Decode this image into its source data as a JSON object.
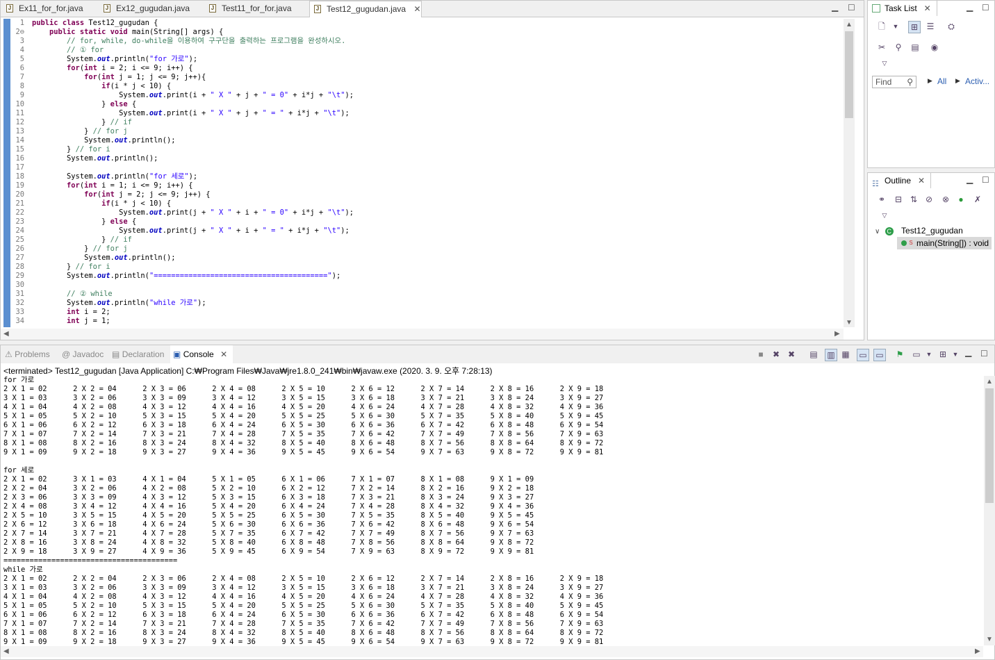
{
  "editor": {
    "tabs": [
      {
        "label": "Ex11_for_for.java",
        "active": false
      },
      {
        "label": "Ex12_gugudan.java",
        "active": false
      },
      {
        "label": "Test11_for_for.java",
        "active": false
      },
      {
        "label": "Test12_gugudan.java",
        "active": true
      }
    ],
    "code_lines": [
      {
        "n": "1",
        "t": "public class Test12_gugudan {"
      },
      {
        "n": "2⊖",
        "t": "    public static void main(String[] args) {"
      },
      {
        "n": "3",
        "t": "        // for, while, do-while을 이용하여 구구단을 출력하는 프로그램을 완성하시오."
      },
      {
        "n": "4",
        "t": "        // ① for"
      },
      {
        "n": "5",
        "t": "        System.out.println(\"for 가로\");"
      },
      {
        "n": "6",
        "t": "        for(int i = 2; i <= 9; i++) {"
      },
      {
        "n": "7",
        "t": "            for(int j = 1; j <= 9; j++){"
      },
      {
        "n": "8",
        "t": "                if(i * j < 10) {"
      },
      {
        "n": "9",
        "t": "                    System.out.print(i + \" X \" + j + \" = 0\" + i*j + \"\\t\");"
      },
      {
        "n": "10",
        "t": "                } else {"
      },
      {
        "n": "11",
        "t": "                    System.out.print(i + \" X \" + j + \" = \" + i*j + \"\\t\");"
      },
      {
        "n": "12",
        "t": "                } // if"
      },
      {
        "n": "13",
        "t": "            } // for j"
      },
      {
        "n": "14",
        "t": "            System.out.println();"
      },
      {
        "n": "15",
        "t": "        } // for i"
      },
      {
        "n": "16",
        "t": "        System.out.println();"
      },
      {
        "n": "17",
        "t": ""
      },
      {
        "n": "18",
        "t": "        System.out.println(\"for 세로\");"
      },
      {
        "n": "19",
        "t": "        for(int i = 1; i <= 9; i++) {"
      },
      {
        "n": "20",
        "t": "            for(int j = 2; j <= 9; j++) {"
      },
      {
        "n": "21",
        "t": "                if(i * j < 10) {"
      },
      {
        "n": "22",
        "t": "                    System.out.print(j + \" X \" + i + \" = 0\" + i*j + \"\\t\");"
      },
      {
        "n": "23",
        "t": "                } else {"
      },
      {
        "n": "24",
        "t": "                    System.out.print(j + \" X \" + i + \" = \" + i*j + \"\\t\");"
      },
      {
        "n": "25",
        "t": "                } // if"
      },
      {
        "n": "26",
        "t": "            } // for j"
      },
      {
        "n": "27",
        "t": "            System.out.println();"
      },
      {
        "n": "28",
        "t": "        } // for i"
      },
      {
        "n": "29",
        "t": "        System.out.println(\"========================================\");"
      },
      {
        "n": "30",
        "t": ""
      },
      {
        "n": "31",
        "t": "        // ② while"
      },
      {
        "n": "32",
        "t": "        System.out.println(\"while 가로\");"
      },
      {
        "n": "33",
        "t": "        int i = 2;"
      },
      {
        "n": "34",
        "t": "        int j = 1;"
      }
    ]
  },
  "task_list": {
    "title": "Task List",
    "find_placeholder": "Find",
    "filter_all": "All",
    "filter_activate": "Activ..."
  },
  "outline": {
    "title": "Outline",
    "class_name": "Test12_gugudan",
    "method": "main(String[]) : void"
  },
  "console": {
    "tabs": [
      {
        "label": "Problems",
        "active": false
      },
      {
        "label": "Javadoc",
        "active": false
      },
      {
        "label": "Declaration",
        "active": false
      },
      {
        "label": "Console",
        "active": true
      }
    ],
    "status": "<terminated> Test12_gugudan [Java Application] C:₩Program Files₩Java₩jre1.8.0_241₩bin₩javaw.exe (2020. 3. 9. 오후 7:28:13)",
    "output": [
      "for 가로",
      "2 X 1 = 02\t2 X 2 = 04\t2 X 3 = 06\t2 X 4 = 08\t2 X 5 = 10\t2 X 6 = 12\t2 X 7 = 14\t2 X 8 = 16\t2 X 9 = 18",
      "3 X 1 = 03\t3 X 2 = 06\t3 X 3 = 09\t3 X 4 = 12\t3 X 5 = 15\t3 X 6 = 18\t3 X 7 = 21\t3 X 8 = 24\t3 X 9 = 27",
      "4 X 1 = 04\t4 X 2 = 08\t4 X 3 = 12\t4 X 4 = 16\t4 X 5 = 20\t4 X 6 = 24\t4 X 7 = 28\t4 X 8 = 32\t4 X 9 = 36",
      "5 X 1 = 05\t5 X 2 = 10\t5 X 3 = 15\t5 X 4 = 20\t5 X 5 = 25\t5 X 6 = 30\t5 X 7 = 35\t5 X 8 = 40\t5 X 9 = 45",
      "6 X 1 = 06\t6 X 2 = 12\t6 X 3 = 18\t6 X 4 = 24\t6 X 5 = 30\t6 X 6 = 36\t6 X 7 = 42\t6 X 8 = 48\t6 X 9 = 54",
      "7 X 1 = 07\t7 X 2 = 14\t7 X 3 = 21\t7 X 4 = 28\t7 X 5 = 35\t7 X 6 = 42\t7 X 7 = 49\t7 X 8 = 56\t7 X 9 = 63",
      "8 X 1 = 08\t8 X 2 = 16\t8 X 3 = 24\t8 X 4 = 32\t8 X 5 = 40\t8 X 6 = 48\t8 X 7 = 56\t8 X 8 = 64\t8 X 9 = 72",
      "9 X 1 = 09\t9 X 2 = 18\t9 X 3 = 27\t9 X 4 = 36\t9 X 5 = 45\t9 X 6 = 54\t9 X 7 = 63\t9 X 8 = 72\t9 X 9 = 81",
      "",
      "for 세로",
      "2 X 1 = 02\t3 X 1 = 03\t4 X 1 = 04\t5 X 1 = 05\t6 X 1 = 06\t7 X 1 = 07\t8 X 1 = 08\t9 X 1 = 09",
      "2 X 2 = 04\t3 X 2 = 06\t4 X 2 = 08\t5 X 2 = 10\t6 X 2 = 12\t7 X 2 = 14\t8 X 2 = 16\t9 X 2 = 18",
      "2 X 3 = 06\t3 X 3 = 09\t4 X 3 = 12\t5 X 3 = 15\t6 X 3 = 18\t7 X 3 = 21\t8 X 3 = 24\t9 X 3 = 27",
      "2 X 4 = 08\t3 X 4 = 12\t4 X 4 = 16\t5 X 4 = 20\t6 X 4 = 24\t7 X 4 = 28\t8 X 4 = 32\t9 X 4 = 36",
      "2 X 5 = 10\t3 X 5 = 15\t4 X 5 = 20\t5 X 5 = 25\t6 X 5 = 30\t7 X 5 = 35\t8 X 5 = 40\t9 X 5 = 45",
      "2 X 6 = 12\t3 X 6 = 18\t4 X 6 = 24\t5 X 6 = 30\t6 X 6 = 36\t7 X 6 = 42\t8 X 6 = 48\t9 X 6 = 54",
      "2 X 7 = 14\t3 X 7 = 21\t4 X 7 = 28\t5 X 7 = 35\t6 X 7 = 42\t7 X 7 = 49\t8 X 7 = 56\t9 X 7 = 63",
      "2 X 8 = 16\t3 X 8 = 24\t4 X 8 = 32\t5 X 8 = 40\t6 X 8 = 48\t7 X 8 = 56\t8 X 8 = 64\t9 X 8 = 72",
      "2 X 9 = 18\t3 X 9 = 27\t4 X 9 = 36\t5 X 9 = 45\t6 X 9 = 54\t7 X 9 = 63\t8 X 9 = 72\t9 X 9 = 81",
      "========================================",
      "while 가로",
      "2 X 1 = 02\t2 X 2 = 04\t2 X 3 = 06\t2 X 4 = 08\t2 X 5 = 10\t2 X 6 = 12\t2 X 7 = 14\t2 X 8 = 16\t2 X 9 = 18",
      "3 X 1 = 03\t3 X 2 = 06\t3 X 3 = 09\t3 X 4 = 12\t3 X 5 = 15\t3 X 6 = 18\t3 X 7 = 21\t3 X 8 = 24\t3 X 9 = 27",
      "4 X 1 = 04\t4 X 2 = 08\t4 X 3 = 12\t4 X 4 = 16\t4 X 5 = 20\t4 X 6 = 24\t4 X 7 = 28\t4 X 8 = 32\t4 X 9 = 36",
      "5 X 1 = 05\t5 X 2 = 10\t5 X 3 = 15\t5 X 4 = 20\t5 X 5 = 25\t5 X 6 = 30\t5 X 7 = 35\t5 X 8 = 40\t5 X 9 = 45",
      "6 X 1 = 06\t6 X 2 = 12\t6 X 3 = 18\t6 X 4 = 24\t6 X 5 = 30\t6 X 6 = 36\t6 X 7 = 42\t6 X 8 = 48\t6 X 9 = 54",
      "7 X 1 = 07\t7 X 2 = 14\t7 X 3 = 21\t7 X 4 = 28\t7 X 5 = 35\t7 X 6 = 42\t7 X 7 = 49\t7 X 8 = 56\t7 X 9 = 63",
      "8 X 1 = 08\t8 X 2 = 16\t8 X 3 = 24\t8 X 4 = 32\t8 X 5 = 40\t8 X 6 = 48\t8 X 7 = 56\t8 X 8 = 64\t8 X 9 = 72",
      "9 X 1 = 09\t9 X 2 = 18\t9 X 3 = 27\t9 X 4 = 36\t9 X 5 = 45\t9 X 6 = 54\t9 X 7 = 63\t9 X 8 = 72\t9 X 9 = 81"
    ]
  }
}
